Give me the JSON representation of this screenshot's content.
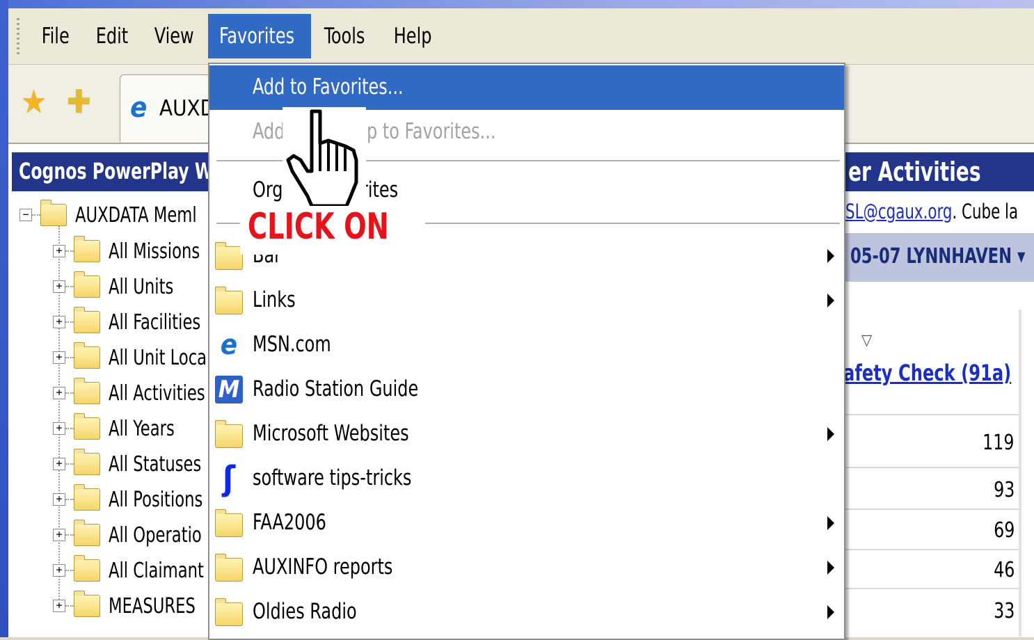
{
  "menubar": {
    "items": [
      {
        "label": "File"
      },
      {
        "label": "Edit"
      },
      {
        "label": "View"
      },
      {
        "label": "Favorites",
        "active": true
      },
      {
        "label": "Tools"
      },
      {
        "label": "Help"
      }
    ]
  },
  "toolbar": {
    "tab_label": "AUXDA",
    "favorites_icon": "favorites-star-icon",
    "add_favorites_icon": "add-to-favorites-star-icon"
  },
  "content": {
    "cognos_title": "Cognos PowerPlay W",
    "cube_title": "er Activities",
    "email_link": "SL@cgaux.org",
    "email_suffix": ". Cube la",
    "dimension_label": "05-07 LYNNHAVEN ▾",
    "tree": {
      "root": "AUXDATA Meml",
      "items": [
        "All Missions",
        "All Units",
        "All Facilities",
        "All Unit Loca",
        "All Activities",
        "All Years",
        "All Statuses",
        "All Positions",
        "All Operatio",
        "All Claimant",
        "MEASURES"
      ]
    },
    "column_header": "afety Check (91a)",
    "values": [
      "119",
      "93",
      "69",
      "46",
      "33"
    ]
  },
  "favorites_menu": {
    "add_to_favorites": "Add to Favorites...",
    "add_tab_group": "Add",
    "add_tab_group_tail": "p to Favorites...",
    "organize_head": "Org",
    "organize_tail": "rites",
    "bar_tail": "Bar",
    "items": [
      {
        "label": "Links",
        "icon": "folder-icon",
        "submenu": true
      },
      {
        "label": "MSN.com",
        "icon": "ie-page-icon",
        "submenu": false
      },
      {
        "label": "Radio Station Guide",
        "icon": "msn-m-icon",
        "submenu": false
      },
      {
        "label": "Microsoft Websites",
        "icon": "folder-icon",
        "submenu": true
      },
      {
        "label": "software tips-tricks",
        "icon": "s-logo-icon",
        "submenu": false
      },
      {
        "label": "FAA2006",
        "icon": "folder-icon",
        "submenu": true
      },
      {
        "label": "AUXINFO reports",
        "icon": "folder-icon",
        "submenu": true
      },
      {
        "label": "Oldies Radio",
        "icon": "folder-icon",
        "submenu": true
      }
    ]
  },
  "callout": {
    "text": "CLICK ON",
    "color": "#e8121a"
  },
  "colors": {
    "menu_highlight": "#316ac5",
    "cognos_bar": "#22358a",
    "link": "#1a2fc2"
  }
}
